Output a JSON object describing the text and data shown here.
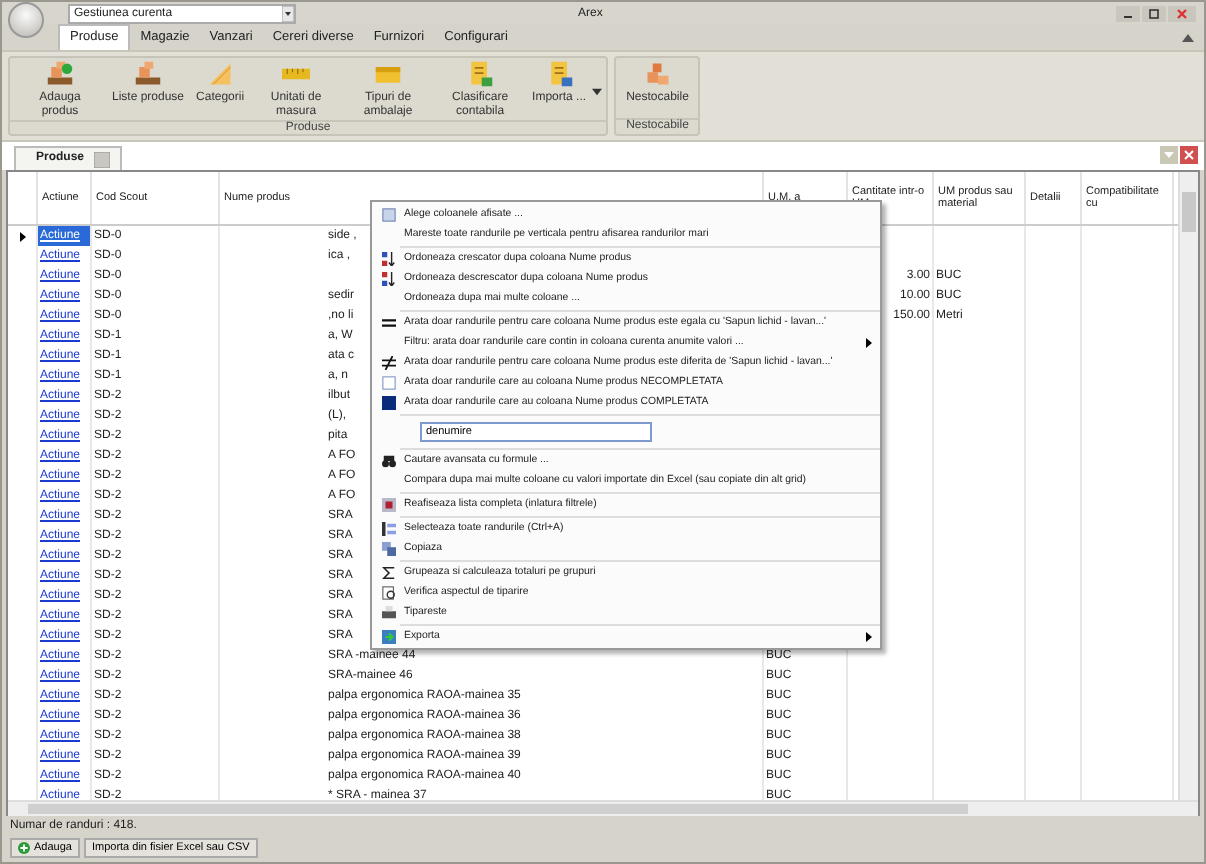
{
  "window": {
    "title": "Arex"
  },
  "quick_access": {
    "combo_value": "Gestiunea curenta"
  },
  "ribbon_tabs": [
    {
      "label": "Produse",
      "selected": true
    },
    {
      "label": "Magazie",
      "selected": false
    },
    {
      "label": "Vanzari",
      "selected": false
    },
    {
      "label": "Cereri diverse",
      "selected": false
    },
    {
      "label": "Furnizori",
      "selected": false
    },
    {
      "label": "Configurari",
      "selected": false
    }
  ],
  "ribbon_groups": [
    {
      "label": "Produse",
      "has_more": true,
      "buttons": [
        {
          "label": "Adauga produs"
        },
        {
          "label": "Liste produse"
        },
        {
          "label": "Categorii"
        },
        {
          "label": "Unitati de masura"
        },
        {
          "label": "Tipuri de ambalaje"
        },
        {
          "label": "Clasificare contabila"
        },
        {
          "label": "Importa ..."
        }
      ]
    },
    {
      "label": "Nestocabile",
      "has_more": false,
      "buttons": [
        {
          "label": "Nestocabile"
        }
      ]
    }
  ],
  "document_tabs": [
    {
      "label": "Produse",
      "selected": true
    }
  ],
  "grid": {
    "columns": [
      "Actiune",
      "Cod Scout",
      "Nume produs",
      "U.M. a",
      "Cantitate intr-o UM",
      "UM produs sau material",
      "Detalii",
      "Compatibilitate cu"
    ],
    "rows": [
      {
        "selected": true,
        "action": "Actiune",
        "code": "SD-0",
        "name": "side ,"
      },
      {
        "selected": false,
        "action": "Actiune",
        "code": "SD-0",
        "name": "ica ,"
      },
      {
        "selected": false,
        "action": "Actiune",
        "code": "SD-0",
        "qty": "3.00",
        "um_product": "BUC"
      },
      {
        "selected": false,
        "action": "Actiune",
        "code": "SD-0",
        "name": "sedir",
        "qty": "10.00",
        "um_product": "BUC"
      },
      {
        "selected": false,
        "action": "Actiune",
        "code": "SD-0",
        "name": ",no li",
        "qty": "150.00",
        "um_product": "Metri"
      },
      {
        "selected": false,
        "action": "Actiune",
        "code": "SD-1",
        "name": "a, W"
      },
      {
        "selected": false,
        "action": "Actiune",
        "code": "SD-1",
        "name": "ata c"
      },
      {
        "selected": false,
        "action": "Actiune",
        "code": "SD-1",
        "name": "a, n"
      },
      {
        "selected": false,
        "action": "Actiune",
        "code": "SD-2",
        "name": "ilbut"
      },
      {
        "selected": false,
        "action": "Actiune",
        "code": "SD-2",
        "name": "(L),"
      },
      {
        "selected": false,
        "action": "Actiune",
        "code": "SD-2",
        "name": "pita"
      },
      {
        "selected": false,
        "action": "Actiune",
        "code": "SD-2",
        "name": "A FO"
      },
      {
        "selected": false,
        "action": "Actiune",
        "code": "SD-2",
        "name": "A FO"
      },
      {
        "selected": false,
        "action": "Actiune",
        "code": "SD-2",
        "name": "A FO"
      },
      {
        "selected": false,
        "action": "Actiune",
        "code": "SD-2",
        "name": "SRA"
      },
      {
        "selected": false,
        "action": "Actiune",
        "code": "SD-2",
        "name": "SRA"
      },
      {
        "selected": false,
        "action": "Actiune",
        "code": "SD-2",
        "name": "SRA"
      },
      {
        "selected": false,
        "action": "Actiune",
        "code": "SD-2",
        "name": "SRA"
      },
      {
        "selected": false,
        "action": "Actiune",
        "code": "SD-2",
        "name": "SRA"
      },
      {
        "selected": false,
        "action": "Actiune",
        "code": "SD-2",
        "name": "SRA"
      },
      {
        "selected": false,
        "action": "Actiune",
        "code": "SD-2",
        "name": "SRA"
      },
      {
        "selected": false,
        "action": "Actiune",
        "code": "SD-2",
        "name": "SRA -mainee 44",
        "um": "BUC"
      },
      {
        "selected": false,
        "action": "Actiune",
        "code": "SD-2",
        "name": "SRA-mainee 46",
        "um": "BUC"
      },
      {
        "selected": false,
        "action": "Actiune",
        "code": "SD-2",
        "name": "palpa ergonomica RAOA-mainea 35",
        "um": "BUC"
      },
      {
        "selected": false,
        "action": "Actiune",
        "code": "SD-2",
        "name": "palpa ergonomica RAOA-mainea 36",
        "um": "BUC"
      },
      {
        "selected": false,
        "action": "Actiune",
        "code": "SD-2",
        "name": "palpa ergonomica RAOA-mainea 38",
        "um": "BUC"
      },
      {
        "selected": false,
        "action": "Actiune",
        "code": "SD-2",
        "name": "palpa ergonomica RAOA-mainea 39",
        "um": "BUC"
      },
      {
        "selected": false,
        "action": "Actiune",
        "code": "SD-2",
        "name": "palpa ergonomica RAOA-mainea 40",
        "um": "BUC"
      },
      {
        "selected": false,
        "action": "Actiune",
        "code": "SD-2",
        "name": "* SRA - mainea 37",
        "um": "BUC"
      }
    ]
  },
  "context_menu": {
    "groups": [
      {
        "kind": "items",
        "items": [
          {
            "label": "Alege coloanele afisate ...",
            "submenu": false
          },
          {
            "label": "Mareste toate randurile pe verticala pentru afisarea randurilor mari",
            "submenu": false
          }
        ]
      },
      {
        "kind": "items",
        "items": [
          {
            "label": "Ordoneaza crescator dupa coloana Nume produs",
            "submenu": false
          },
          {
            "label": "Ordoneaza descrescator dupa coloana Nume produs",
            "submenu": false
          },
          {
            "label": "Ordoneaza dupa mai multe coloane ...",
            "submenu": false
          }
        ]
      },
      {
        "kind": "items",
        "items": [
          {
            "label": "Arata doar randurile pentru care coloana Nume produs este egala cu 'Sapun lichid - lavan...'",
            "submenu": false
          },
          {
            "label": "Filtru: arata doar randurile care contin in coloana curenta anumite valori ...",
            "submenu": true
          },
          {
            "label": "Arata doar randurile pentru care coloana Nume produs este diferita de 'Sapun lichid - lavan...'",
            "submenu": false
          },
          {
            "label": "Arata doar randurile care au coloana Nume produs NECOMPLETATA",
            "submenu": false
          },
          {
            "label": "Arata doar randurile care au coloana Nume produs COMPLETATA",
            "submenu": false
          }
        ]
      },
      {
        "kind": "search",
        "value": "denumire"
      },
      {
        "kind": "items",
        "items": [
          {
            "label": "Cautare avansata cu formule ...",
            "submenu": false
          },
          {
            "label": "Compara dupa mai multe coloane cu valori importate din Excel (sau copiate din alt grid)",
            "submenu": false
          }
        ]
      },
      {
        "kind": "items",
        "items": [
          {
            "label": "Reafiseaza lista completa (inlatura filtrele)",
            "submenu": false
          }
        ]
      },
      {
        "kind": "items",
        "items": [
          {
            "label": "Selecteaza toate randurile (Ctrl+A)",
            "submenu": false
          },
          {
            "label": "Copiaza",
            "submenu": false
          }
        ]
      },
      {
        "kind": "items",
        "items": [
          {
            "label": "Grupeaza si calculeaza totaluri pe grupuri",
            "submenu": false
          },
          {
            "label": "Verifica aspectul de tiparire",
            "submenu": false
          },
          {
            "label": "Tipareste",
            "submenu": false
          }
        ]
      },
      {
        "kind": "items",
        "items": [
          {
            "label": "Exporta",
            "submenu": true
          }
        ]
      }
    ]
  },
  "status_bar": {
    "text": "Numar de randuri : 418."
  },
  "bottom_buttons": [
    {
      "label": "Adauga"
    },
    {
      "label": "Importa din fisier Excel sau CSV"
    }
  ]
}
